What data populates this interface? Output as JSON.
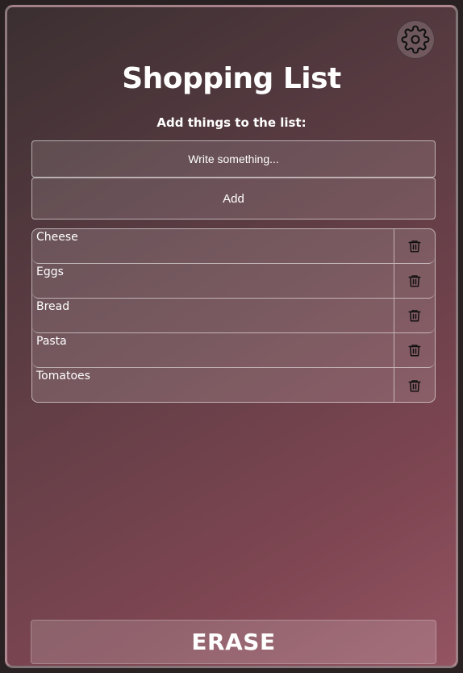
{
  "app": {
    "title": "Shopping List",
    "subtitle": "Add things to the list:",
    "settings_icon": "gear-icon"
  },
  "form": {
    "input_value": "",
    "input_placeholder": "Write something...",
    "add_label": "Add"
  },
  "list": {
    "items": [
      {
        "label": "Cheese",
        "icon": "trash-icon"
      },
      {
        "label": "Eggs",
        "icon": "trash-icon"
      },
      {
        "label": "Bread",
        "icon": "trash-icon"
      },
      {
        "label": "Pasta",
        "icon": "trash-icon"
      },
      {
        "label": "Tomatoes",
        "icon": "trash-icon"
      }
    ]
  },
  "footer": {
    "erase_label": "ERASE"
  },
  "colors": {
    "background_start": "#3b2f31",
    "background_end": "#945462",
    "text": "#ffffff",
    "icon": "#111111"
  }
}
